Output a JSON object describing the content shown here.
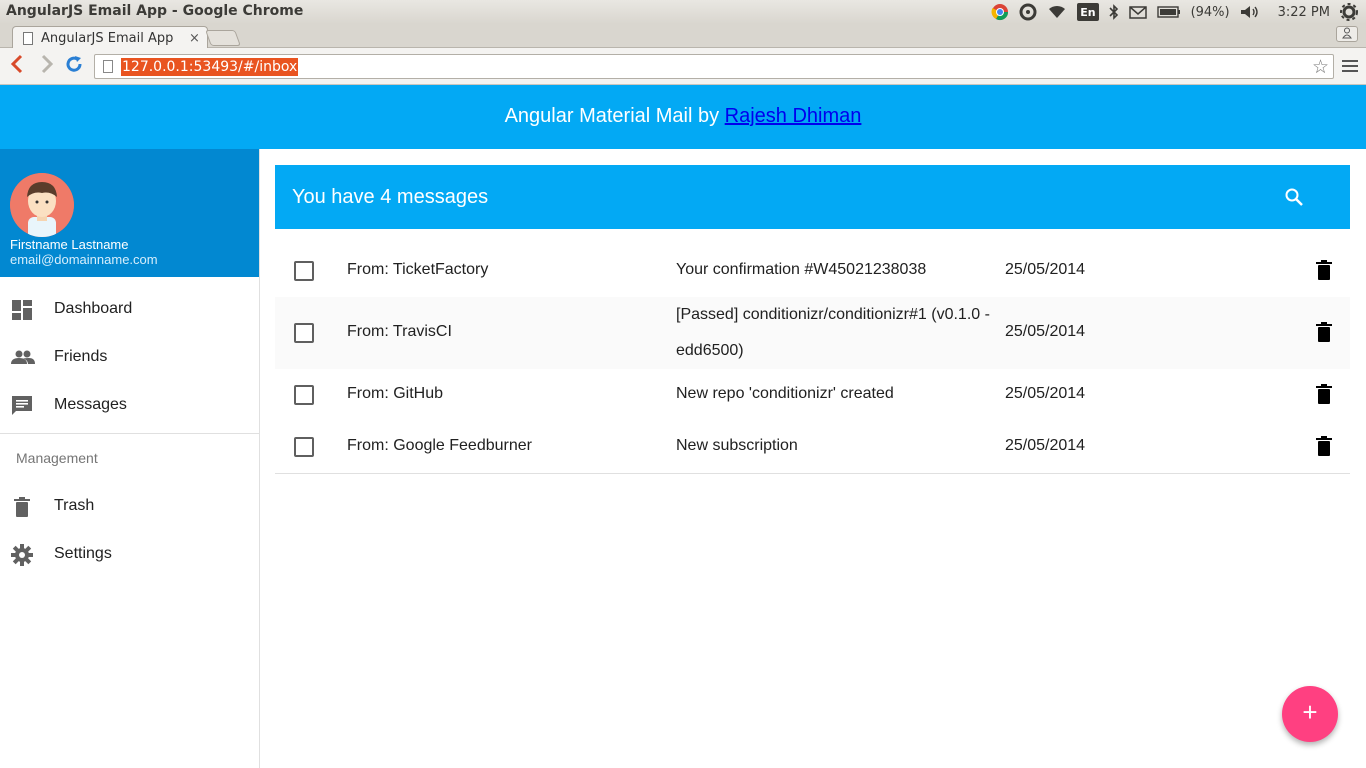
{
  "window": {
    "title": "AngularJS Email App - Google Chrome",
    "battery": "(94%)",
    "clock": "3:22 PM",
    "lang": "En"
  },
  "browser": {
    "tab_title": "AngularJS Email App",
    "tab_close": "×",
    "url": "127.0.0.1:53493/#/inbox"
  },
  "header": {
    "prefix": "Angular Material Mail by ",
    "author_link": "Rajesh Dhiman"
  },
  "sidebar": {
    "name": "Firstname Lastname",
    "email": "email@domainname.com",
    "items": [
      {
        "label": "Dashboard",
        "icon": "dashboard-icon"
      },
      {
        "label": "Friends",
        "icon": "people-icon"
      },
      {
        "label": "Messages",
        "icon": "message-icon"
      }
    ],
    "management_header": "Management",
    "management_items": [
      {
        "label": "Trash",
        "icon": "trash-icon"
      },
      {
        "label": "Settings",
        "icon": "gear-icon"
      }
    ]
  },
  "inbox": {
    "count_text": "You have 4 messages",
    "messages": [
      {
        "from": "From: TicketFactory",
        "subject": "Your confirmation #W45021238038",
        "date": "25/05/2014"
      },
      {
        "from": "From: TravisCI",
        "subject": "[Passed] conditionizr/conditionizr#1 (v0.1.0 - edd6500)",
        "date": "25/05/2014"
      },
      {
        "from": "From: GitHub",
        "subject": "New repo 'conditionizr' created",
        "date": "25/05/2014"
      },
      {
        "from": "From: Google Feedburner",
        "subject": "New subscription",
        "date": "25/05/2014"
      }
    ]
  },
  "fab": {
    "label": "+"
  },
  "colors": {
    "primary": "#03a9f4",
    "primary_dark": "#0288d1",
    "accent": "#ff4081"
  }
}
